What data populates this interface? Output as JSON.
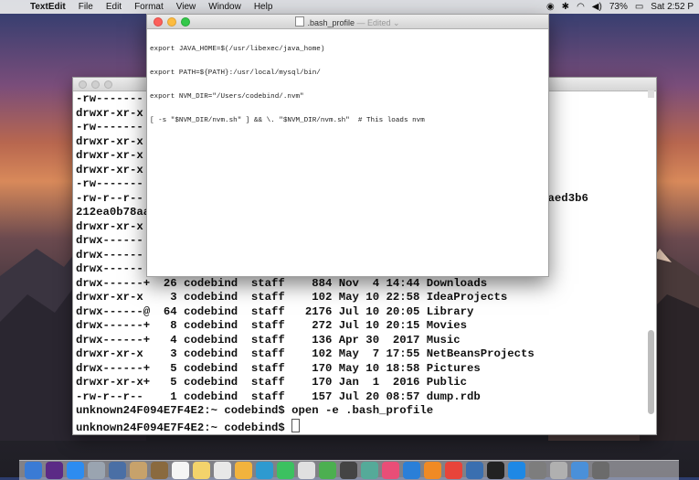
{
  "menubar": {
    "app_name": "TextEdit",
    "items": [
      "File",
      "Edit",
      "Format",
      "View",
      "Window",
      "Help"
    ],
    "battery": "73%",
    "clock": "Sat 2:52 P"
  },
  "textedit": {
    "doc_name": ".bash_profile",
    "status": "— Edited ⌄",
    "lines": [
      "export JAVA_HOME=$(/usr/libexec/java_home)",
      "export PATH=${PATH}:/usr/local/mysql/bin/",
      "export NVM_DIR=\"/Users/codebind/.nvm\"",
      "[ -s \"$NVM_DIR/nvm.sh\" ] && \\. \"$NVM_DIR/nvm.sh\"  # This loads nvm"
    ]
  },
  "terminal": {
    "lines": [
      "-rw-------",
      "drwxr-xr-x",
      "-rw-------",
      "drwxr-xr-x",
      "drwxr-xr-x",
      "drwxr-xr-x",
      "-rw-------",
      "-rw-r--r--                                                    3.38523eaed3b6",
      "212ea0b78aa",
      "drwxr-xr-x",
      "drwx------",
      "drwx------",
      "drwx------",
      "drwx------+  26 codebind  staff    884 Nov  4 14:44 Downloads",
      "drwxr-xr-x    3 codebind  staff    102 May 10 22:58 IdeaProjects",
      "drwx------@  64 codebind  staff   2176 Jul 10 20:05 Library",
      "drwx------+   8 codebind  staff    272 Jul 10 20:15 Movies",
      "drwx------+   4 codebind  staff    136 Apr 30  2017 Music",
      "drwxr-xr-x    3 codebind  staff    102 May  7 17:55 NetBeansProjects",
      "drwx------+   5 codebind  staff    170 May 10 18:58 Pictures",
      "drwxr-xr-x+   5 codebind  staff    170 Jan  1  2016 Public",
      "-rw-r--r--    1 codebind  staff    157 Jul 20 08:57 dump.rdb",
      "unknown24F094E7F4E2:~ codebind$ open -e .bash_profile"
    ],
    "prompt": "unknown24F094E7F4E2:~ codebind$ "
  },
  "dock": {
    "colors": [
      "#3a7bd5",
      "#5b2a86",
      "#2d8cf0",
      "#9aa4b0",
      "#4a6fa5",
      "#c7a26b",
      "#8a6a3f",
      "#f5f5f5",
      "#f3d36b",
      "#e8e8e8",
      "#f2b33d",
      "#2e9ad0",
      "#3cc160",
      "#e0e0e0",
      "#4caf50",
      "#444",
      "#5a9",
      "#e94e77",
      "#2a7fd8",
      "#f08a24",
      "#e8443a",
      "#3a6fb0",
      "#222",
      "#1e88e5",
      "#7d7d7d",
      "#b0b0b0",
      "#4a90d9",
      "#6b6b6b"
    ]
  }
}
